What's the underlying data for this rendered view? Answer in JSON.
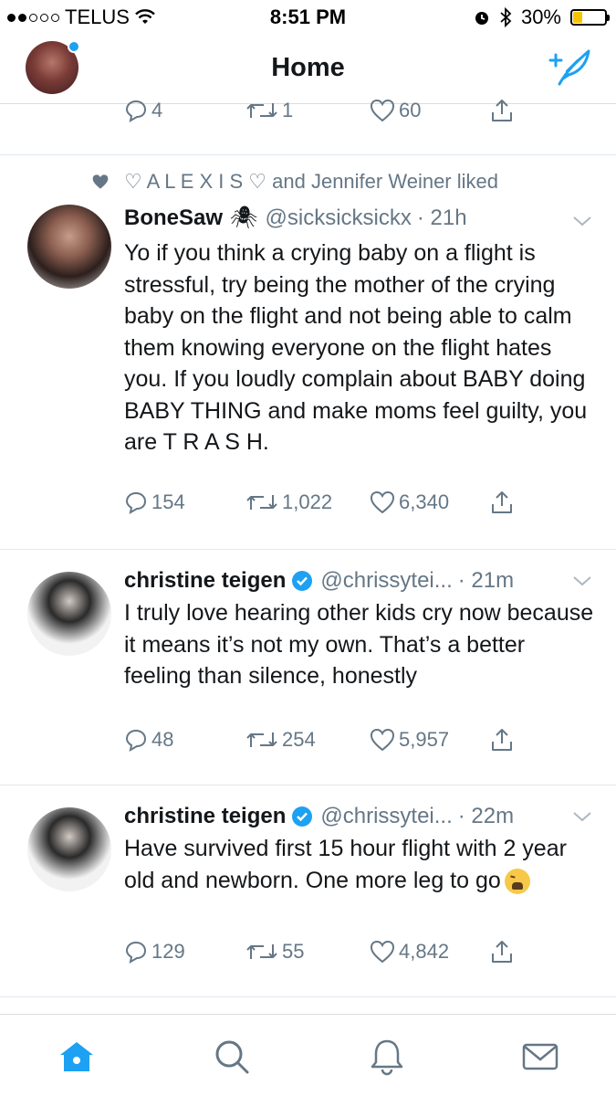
{
  "status_bar": {
    "carrier": "TELUS",
    "time": "8:51 PM",
    "battery": "30%",
    "battery_level": 0.3
  },
  "header": {
    "title": "Home",
    "avatar_icon": "profile-avatar",
    "compose_icon": "compose-tweet-icon"
  },
  "top_tweet_actions": {
    "replies": "4",
    "retweets": "1",
    "likes": "60"
  },
  "tweets": [
    {
      "social_context": "♡ A L E X I S ♡ and Jennifer Weiner liked",
      "name": "BoneSaw",
      "name_emoji": "🕷",
      "handle": "@sicksicksickx",
      "time": "· 21h",
      "text": "Yo if you think a crying baby on a flight is stressful, try being the mother of the crying baby on the flight and not being able to calm them knowing everyone on the flight hates you. If you loudly complain about BABY doing BABY THING and make moms feel guilty, you are T R A S H.",
      "replies": "154",
      "retweets": "1,022",
      "likes": "6,340"
    },
    {
      "name": "christine teigen",
      "verified": true,
      "handle": "@chrissytei...",
      "time": "· 21m",
      "text": "I truly love hearing other kids cry now because it means it’s not my own. That’s a better feeling than silence, honestly",
      "replies": "48",
      "retweets": "254",
      "likes": "5,957"
    },
    {
      "name": "christine teigen",
      "verified": true,
      "handle": "@chrissytei...",
      "time": "· 22m",
      "text": "Have survived first 15 hour flight with 2 year old and newborn. One more leg to go",
      "replies": "129",
      "retweets": "55",
      "likes": "4,842"
    }
  ],
  "tab_bar": {
    "items": [
      "home-icon",
      "search-icon",
      "notifications-icon",
      "messages-icon"
    ],
    "active_color": "#1da1f2"
  }
}
